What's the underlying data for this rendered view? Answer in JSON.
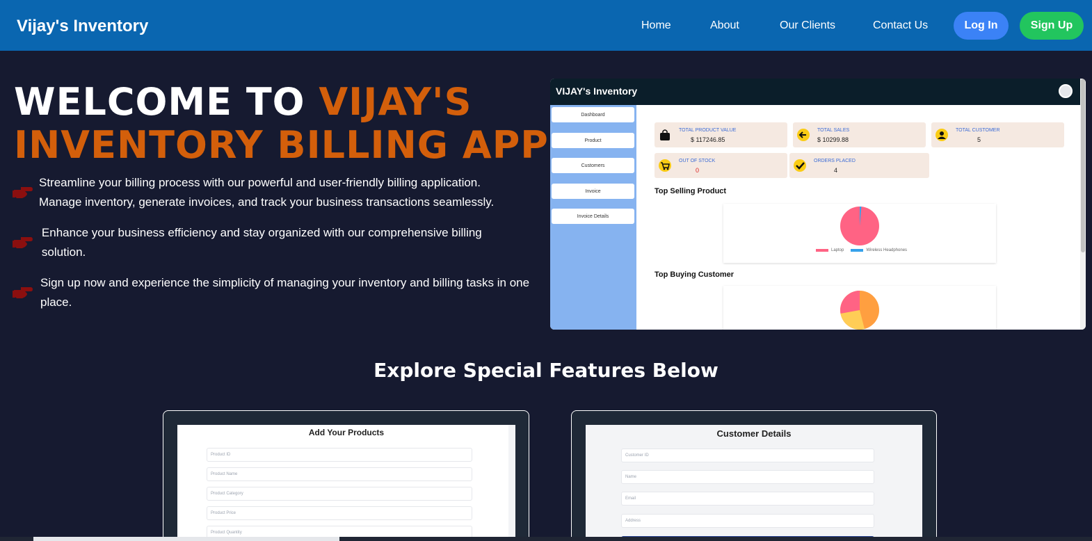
{
  "nav": {
    "brand": "Vijay's Inventory",
    "links": [
      "Home",
      "About",
      "Our Clients",
      "Contact Us"
    ],
    "login": "Log In",
    "signup": "Sign Up"
  },
  "hero": {
    "title_white": "WELCOME TO ",
    "title_orange_1": "VIJAY'S",
    "title_orange_2": "INVENTORY BILLING APP",
    "points": [
      "Streamline your billing process with our powerful and user-friendly billing application. Manage inventory, generate invoices, and track your business transactions seamlessly.",
      "Enhance your business efficiency and stay organized with our comprehensive billing solution.",
      "Sign up now and experience the simplicity of managing your inventory and billing tasks in one place."
    ]
  },
  "preview": {
    "title": "VIJAY's Inventory",
    "sidebar": [
      "Dashboard",
      "Product",
      "Customers",
      "Invoice",
      "Invoice Details"
    ],
    "cards": [
      {
        "label": "TOTAL PRODUCT VALUE",
        "value": "$ 117246.85",
        "icon": "shopping-bag-icon"
      },
      {
        "label": "TOTAL SALES",
        "value": "$ 10299.88",
        "icon": "arrow-left-icon"
      },
      {
        "label": "TOTAL CUSTOMER",
        "value": "5",
        "icon": "user-icon"
      },
      {
        "label": "OUT OF STOCK",
        "value": "0",
        "icon": "cart-icon"
      },
      {
        "label": "ORDERS PLACED",
        "value": "4",
        "icon": "check-icon"
      }
    ],
    "top_selling_heading": "Top Selling Product",
    "top_selling_legend": [
      "Laptop",
      "Wireless Headphones"
    ],
    "top_buying_heading": "Top Buying Customer",
    "colors": {
      "pink": "#ff6384",
      "blue": "#36a2eb",
      "orange": "#ff9f40",
      "yellow": "#ffcd56"
    }
  },
  "features": {
    "heading": "Explore Special Features Below",
    "product_form": {
      "title": "Add Your Products",
      "fields": [
        "Product ID",
        "Product Name",
        "Product Category",
        "Product Price",
        "Product Quantity"
      ]
    },
    "customer_form": {
      "title": "Customer Details",
      "fields": [
        "Customer ID",
        "Name",
        "Email",
        "Address"
      ]
    }
  },
  "theme": {
    "nav_bg": "#0a66b0",
    "page_bg": "#161a30",
    "accent_orange": "#d35f0b"
  }
}
